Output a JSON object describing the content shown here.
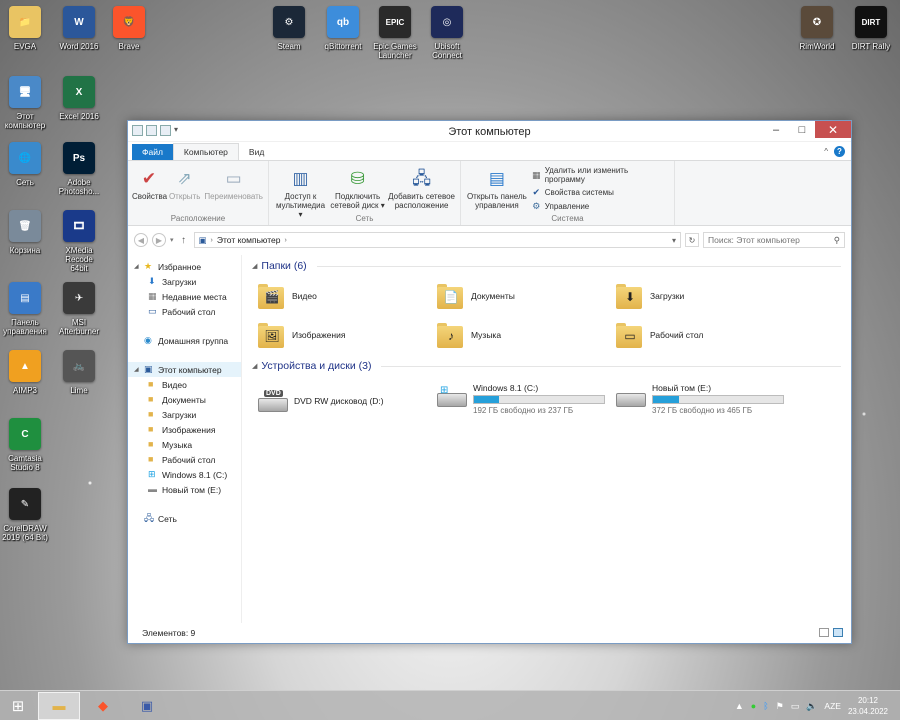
{
  "desktop": {
    "icons": [
      {
        "label": "EVGA",
        "glyph": "📁",
        "color": "#e9c463"
      },
      {
        "label": "Word 2016",
        "glyph": "W",
        "color": "#2b579a"
      },
      {
        "label": "Brave",
        "glyph": "🦁",
        "color": "#fb542b"
      },
      {
        "label": "Steam",
        "glyph": "⚙",
        "color": "#1b2838"
      },
      {
        "label": "qBittorrent",
        "glyph": "qb",
        "color": "#3d8ddb"
      },
      {
        "label": "Epic Games Launcher",
        "glyph": "EPIC",
        "color": "#2a2a2a"
      },
      {
        "label": "Ubisoft Connect",
        "glyph": "◎",
        "color": "#1e2a5a"
      },
      {
        "label": "RimWorld",
        "glyph": "✪",
        "color": "#5a4a3a"
      },
      {
        "label": "DIRT Rally",
        "glyph": "DIRT",
        "color": "#111111"
      },
      {
        "label": "Этот компьютер",
        "glyph": "🖥",
        "color": "#4a89c8"
      },
      {
        "label": "Excel 2016",
        "glyph": "X",
        "color": "#217346"
      },
      {
        "label": "Сеть",
        "glyph": "🌐",
        "color": "#3a8acc"
      },
      {
        "label": "Adobe Photosho...",
        "glyph": "Ps",
        "color": "#001e36"
      },
      {
        "label": "Корзина",
        "glyph": "🗑",
        "color": "#7a8a9a"
      },
      {
        "label": "XMedia Recode 64bit",
        "glyph": "🎞",
        "color": "#1a3a8a"
      },
      {
        "label": "Панель управления",
        "glyph": "▤",
        "color": "#3a7ac8"
      },
      {
        "label": "MSI Afterburner",
        "glyph": "✈",
        "color": "#3a3a3a"
      },
      {
        "label": "AIMP3",
        "glyph": "▲",
        "color": "#f0a020"
      },
      {
        "label": "Lime",
        "glyph": "🚲",
        "color": "#555555"
      },
      {
        "label": "Camtasia Studio 8",
        "glyph": "C",
        "color": "#1f8f3f"
      },
      {
        "label": "CorelDRAW 2019 (64 Bit)",
        "glyph": "✎",
        "color": "#222222"
      }
    ]
  },
  "window": {
    "title": "Этот компьютер",
    "controls": {
      "minimize": "–",
      "maximize": "□",
      "close": "✕"
    },
    "tabs": {
      "file": "Файл",
      "computer": "Компьютер",
      "view": "Вид"
    },
    "ribbon": {
      "location": {
        "label": "Расположение",
        "properties": "Свойства",
        "open": "Открыть",
        "rename": "Переименовать"
      },
      "network": {
        "label": "Сеть",
        "media_access": "Доступ к мультимедиа",
        "map_drive": "Подключить сетевой диск",
        "add_location": "Добавить сетевое расположение"
      },
      "system": {
        "label": "Система",
        "control_panel": "Открыть панель управления",
        "uninstall": "Удалить или изменить программу",
        "system_props": "Свойства системы",
        "manage": "Управление"
      }
    },
    "address": {
      "path": "Этот компьютер",
      "search_placeholder": "Поиск: Этот компьютер"
    },
    "nav": {
      "favorites": "Избранное",
      "downloads": "Загрузки",
      "recent": "Недавние места",
      "desktop": "Рабочий стол",
      "homegroup": "Домашняя группа",
      "this_pc": "Этот компьютер",
      "video": "Видео",
      "documents": "Документы",
      "downloads2": "Загрузки",
      "pictures": "Изображения",
      "music": "Музыка",
      "desktop2": "Рабочий стол",
      "drive_c": "Windows 8.1 (C:)",
      "drive_e": "Новый том (E:)",
      "network": "Сеть"
    },
    "folders_header": "Папки (6)",
    "folders": [
      {
        "name": "Видео",
        "mark": "🎬"
      },
      {
        "name": "Документы",
        "mark": "📄"
      },
      {
        "name": "Загрузки",
        "mark": "⬇"
      },
      {
        "name": "Изображения",
        "mark": "🖼"
      },
      {
        "name": "Музыка",
        "mark": "♪"
      },
      {
        "name": "Рабочий стол",
        "mark": "▭"
      }
    ],
    "devices_header": "Устройства и диски (3)",
    "drives": [
      {
        "name": "DVD RW дисковод (D:)",
        "type": "dvd",
        "free": "",
        "used": null
      },
      {
        "name": "Windows 8.1 (C:)",
        "type": "system",
        "free": "192 ГБ свободно из 237 ГБ",
        "used": 0.19
      },
      {
        "name": "Новый том (E:)",
        "type": "hdd",
        "free": "372 ГБ свободно из 465 ГБ",
        "used": 0.2
      }
    ],
    "status": "Элементов: 9"
  },
  "taskbar": {
    "lang": "AZE",
    "time": "20:12",
    "date": "23.04.2022"
  },
  "colors": {
    "accent": "#1979ca",
    "close": "#c75050",
    "bar_fill": "#26a0da",
    "section_header": "#1e3287"
  }
}
